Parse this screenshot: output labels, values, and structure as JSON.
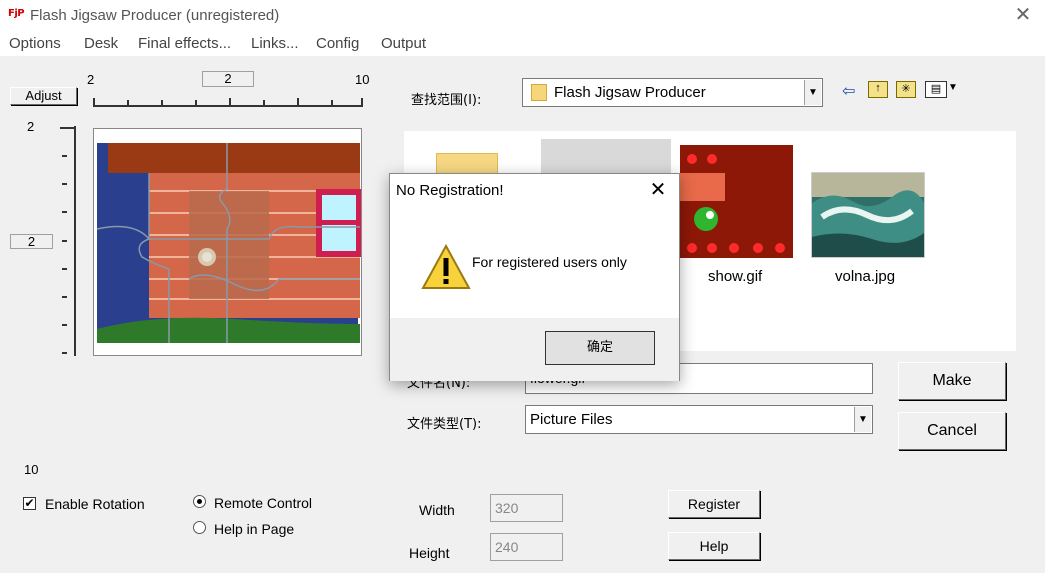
{
  "window": {
    "icon_text": "FjP",
    "title": "Flash Jigsaw Producer (unregistered)"
  },
  "menu": [
    "Options",
    "Desk",
    "Final effects...",
    "Links...",
    "Config",
    "Output"
  ],
  "ruler": {
    "adjust_label": "Adjust",
    "h_min": "2",
    "h_value": "2",
    "h_max": "10",
    "v_min": "2",
    "v_value": "2",
    "v_max": "10"
  },
  "browser": {
    "look_in_label": "查找范围(I):",
    "look_in_value": "Flash Jigsaw Producer",
    "files": [
      {
        "name": "show.gif"
      },
      {
        "name": "volna.jpg"
      }
    ],
    "filename_label": "文件名(N):",
    "filename_value": "flower.gif",
    "filetype_label": "文件类型(T):",
    "filetype_value": "Picture Files",
    "make_label": "Make",
    "cancel_label": "Cancel"
  },
  "options": {
    "enable_rotation": "Enable Rotation",
    "remote_control": "Remote Control",
    "help_in_page": "Help in Page",
    "width_label": "Width",
    "width_value": "320",
    "height_label": "Height",
    "height_value": "240",
    "register_label": "Register",
    "help_label": "Help"
  },
  "dialog": {
    "title": "No Registration!",
    "message": "For registered users only",
    "ok_label": "确定"
  },
  "colors": {
    "wall": "#d4674a",
    "sky": "#2b3f8f",
    "roof": "#9a3a14",
    "window_frame": "#d01e50",
    "grass": "#2f7a2a"
  }
}
